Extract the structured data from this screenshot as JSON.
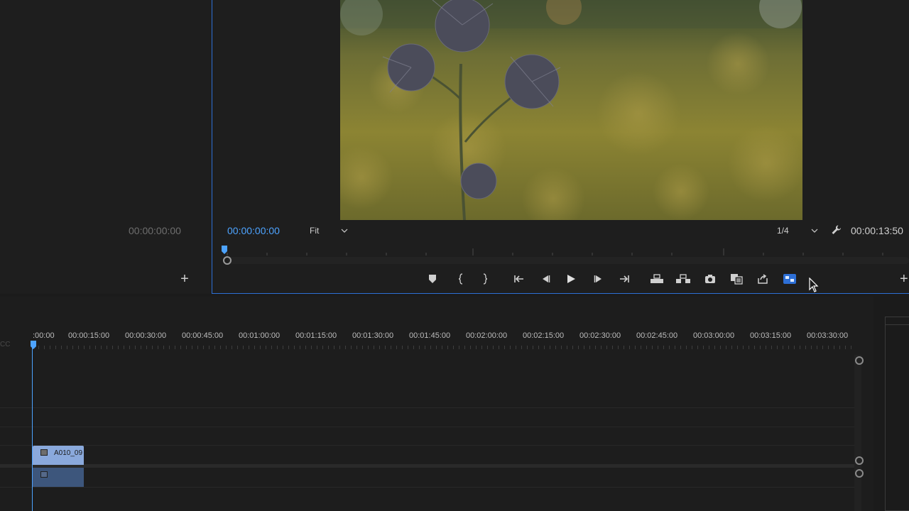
{
  "source_monitor": {
    "timecode": "00:00:00:00",
    "add_label": "+"
  },
  "program_monitor": {
    "timecode": "00:00:00:00",
    "zoom": "Fit",
    "resolution": "1/4",
    "duration": "00:00:13:50",
    "add_label": "+",
    "controls": [
      {
        "name": "add-marker-icon"
      },
      {
        "name": "mark-in-icon"
      },
      {
        "name": "mark-out-icon"
      },
      {
        "name": "go-to-in-icon"
      },
      {
        "name": "step-back-icon"
      },
      {
        "name": "play-icon"
      },
      {
        "name": "step-forward-icon"
      },
      {
        "name": "go-to-out-icon"
      },
      {
        "name": "lift-icon"
      },
      {
        "name": "extract-icon"
      },
      {
        "name": "export-frame-icon"
      },
      {
        "name": "comparison-view-icon"
      },
      {
        "name": "share-icon"
      },
      {
        "name": "vr-video-icon"
      }
    ]
  },
  "timeline": {
    "cc_label": "CC",
    "ruler_labels": [
      ":00:00",
      "00:00:15:00",
      "00:00:30:00",
      "00:00:45:00",
      "00:01:00:00",
      "00:01:15:00",
      "00:01:30:00",
      "00:01:45:00",
      "00:02:00:00",
      "00:02:15:00",
      "00:02:30:00",
      "00:02:45:00",
      "00:03:00:00",
      "00:03:15:00",
      "00:03:30:00"
    ],
    "clip_name": "A010_09"
  },
  "colors": {
    "accent": "#4da3ff",
    "video_clip": "#8aa9dc",
    "audio_clip": "#3d567c",
    "panel_border": "#2d6fd6"
  }
}
